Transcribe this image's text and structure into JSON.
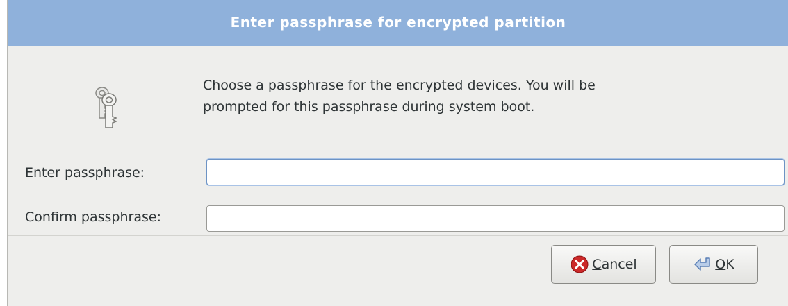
{
  "dialog": {
    "title": "Enter passphrase for encrypted partition",
    "message": "Choose a passphrase for the encrypted devices. You will be prompted for this passphrase during system boot.",
    "icon": "keys-icon"
  },
  "form": {
    "enter_label": "Enter passphrase:",
    "enter_value": "",
    "confirm_label": "Confirm passphrase:",
    "confirm_value": ""
  },
  "buttons": {
    "cancel": {
      "mnemonic": "C",
      "rest": "ancel",
      "icon": "cancel-icon",
      "color": "#cc2a2a"
    },
    "ok": {
      "mnemonic": "O",
      "rest": "K",
      "icon": "ok-arrow-icon",
      "color": "#5a7fb5"
    }
  },
  "colors": {
    "titlebar": "#8fb1db",
    "background": "#eeeeec"
  }
}
